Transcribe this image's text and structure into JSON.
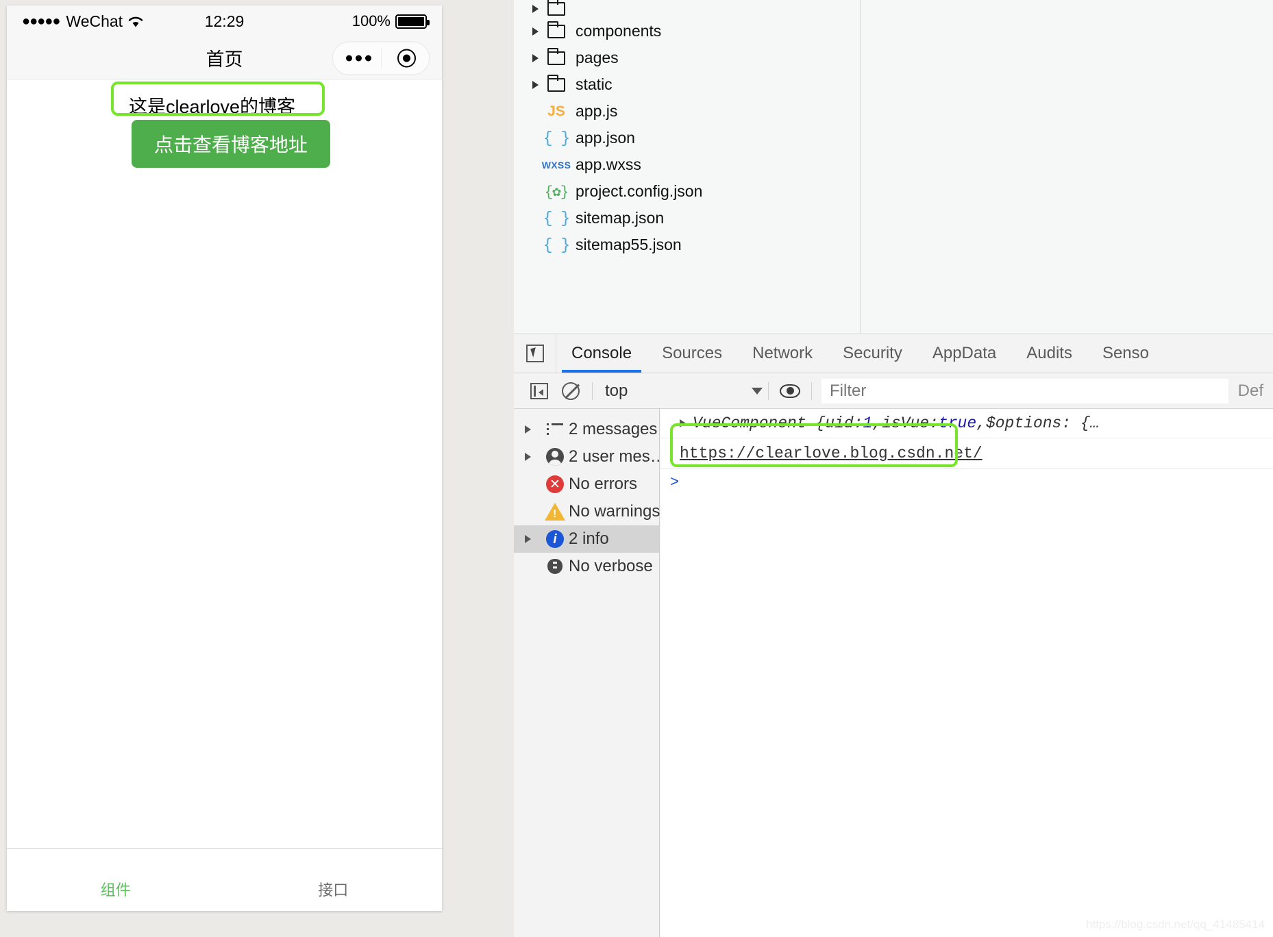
{
  "simulator": {
    "status_bar": {
      "signal_dots": "●●●●●",
      "carrier": "WeChat",
      "wifi_icon": "wifi-icon",
      "time": "12:29",
      "battery_percent": "100%",
      "battery_icon": "battery-full-icon"
    },
    "nav": {
      "title": "首页",
      "capsule": {
        "menu_icon": "more-dots-icon",
        "close_icon": "target-circle-icon"
      }
    },
    "page": {
      "blog_text": "这是clearlove的博客",
      "blog_button_label": "点击查看博客地址",
      "button_color": "#4fae4c",
      "highlight_color": "#76e62a"
    },
    "tabbar": [
      {
        "label": "组件",
        "active": true,
        "color": "#5cc25c"
      },
      {
        "label": "接口",
        "active": false,
        "color": "#6b6b6b"
      }
    ]
  },
  "devtools": {
    "file_tree": [
      {
        "name": "",
        "type": "folder-partial",
        "icon": "folder-icon",
        "expandable": true
      },
      {
        "name": "components",
        "type": "folder",
        "icon": "folder-icon",
        "expandable": true
      },
      {
        "name": "pages",
        "type": "folder",
        "icon": "folder-icon",
        "expandable": true
      },
      {
        "name": "static",
        "type": "folder",
        "icon": "folder-icon",
        "expandable": true
      },
      {
        "name": "app.js",
        "type": "js",
        "icon": "js-icon",
        "expandable": false
      },
      {
        "name": "app.json",
        "type": "json",
        "icon": "json-icon",
        "expandable": false
      },
      {
        "name": "app.wxss",
        "type": "wxss",
        "icon": "wxss-icon",
        "expandable": false
      },
      {
        "name": "project.config.json",
        "type": "config",
        "icon": "config-json-icon",
        "expandable": false
      },
      {
        "name": "sitemap.json",
        "type": "json",
        "icon": "json-icon",
        "expandable": false
      },
      {
        "name": "sitemap55.json",
        "type": "json",
        "icon": "json-icon",
        "expandable": false
      }
    ],
    "tabs": [
      {
        "label": "Console",
        "active": true
      },
      {
        "label": "Sources",
        "active": false
      },
      {
        "label": "Network",
        "active": false
      },
      {
        "label": "Security",
        "active": false
      },
      {
        "label": "AppData",
        "active": false
      },
      {
        "label": "Audits",
        "active": false
      },
      {
        "label": "Senso",
        "active": false
      }
    ],
    "active_tab_underline_color": "#1a73e8",
    "inspect_icon": "inspect-element-icon",
    "toolbar": {
      "sidebar_toggle_icon": "sidebar-toggle-icon",
      "clear_icon": "clear-console-icon",
      "context": "top",
      "caret_icon": "chevron-down-icon",
      "eye_icon": "live-expression-eye-icon",
      "filter_placeholder": "Filter",
      "filter_value": "",
      "levels_label": "Def"
    },
    "sidebar": [
      {
        "label": "2 messages",
        "icon": "list-icon",
        "expandable": true,
        "selected": false
      },
      {
        "label": "2 user mes…",
        "icon": "user-icon",
        "expandable": true,
        "selected": false
      },
      {
        "label": "No errors",
        "icon": "error-icon",
        "expandable": false,
        "selected": false
      },
      {
        "label": "No warnings",
        "icon": "warning-icon",
        "expandable": false,
        "selected": false
      },
      {
        "label": "2 info",
        "icon": "info-icon",
        "expandable": true,
        "selected": true
      },
      {
        "label": "No verbose",
        "icon": "bug-icon",
        "expandable": false,
        "selected": false
      }
    ],
    "console_output": {
      "object_log": {
        "prefix": "VueComponent { ",
        "key1": "uid: ",
        "val1": "1",
        "sep1": ",  ",
        "key2": "isVue: ",
        "val2": "true",
        "sep2": ", ",
        "key3": "$options: {…",
        "expand_icon": "expand-triangle-icon"
      },
      "link": "https://clearlove.blog.csdn.net/",
      "prompt_caret": ">"
    },
    "highlight_color": "#76e62a"
  },
  "watermark": "https://blog.csdn.net/qq_41485414"
}
